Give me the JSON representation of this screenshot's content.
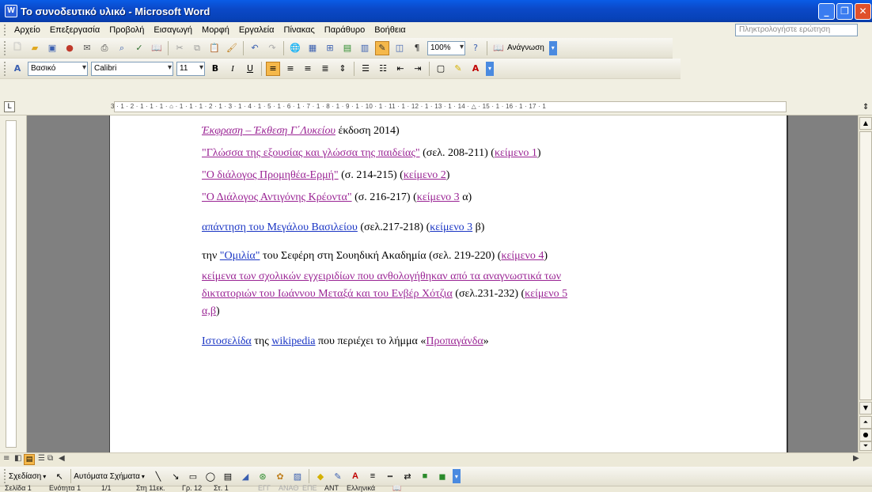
{
  "window": {
    "title": "Το συνοδευτικό υλικό - Microsoft Word"
  },
  "menu": {
    "items": [
      "Αρχείο",
      "Επεξεργασία",
      "Προβολή",
      "Εισαγωγή",
      "Μορφή",
      "Εργαλεία",
      "Πίνακας",
      "Παράθυρο",
      "Βοήθεια"
    ],
    "help_placeholder": "Πληκτρολογήστε ερώτηση"
  },
  "standard_toolbar": {
    "zoom": "100%",
    "reading_label": "Ανάγνωση"
  },
  "format_toolbar": {
    "style": "Βασικό",
    "font": "Calibri",
    "size": "11"
  },
  "ruler": {
    "marks": "3 · 1 · 2 · 1 · 1 · 1 · ⌂ · 1 · 1 · 1 · 2 · 1 · 3 · 1 · 4 · 1 · 5 · 1 · 6 · 1 · 7 · 1 · 8 · 1 · 9 · 1 · 10 · 1 · 11 · 1 · 12 · 1 · 13 · 1 · 14 · △ · 15 · 1 · 16 · 1 · 17 · 1"
  },
  "doc": {
    "l1_link": "Έκφραση – Έκθεση Γ΄Λυκείου",
    "l1_rest": " έκδοση 2014)",
    "l2_link": "\"Γλώσσα της εξουσίας και γλώσσα της παιδείας\"",
    "l2_mid": "  (σελ. 208-211) (",
    "l2_ref": "κείμενο 1",
    "l2_end": ")",
    "l3_link": " \"Ο διάλογος Προμηθέα-Ερμή\"",
    "l3_mid": " (σ. 214-215) (",
    "l3_ref": "κείμενο 2",
    "l3_end": ")",
    "l4_link": "\"Ο Διάλογος Αντιγόνης Κρέοντα\"",
    "l4_mid": " (σ. 216-217) (",
    "l4_ref": "κείμενο 3",
    "l4_end": " α)",
    "l5_link": " απάντηση του Μεγάλου Βασιλείου",
    "l5_mid": "  (σελ.217-218) (",
    "l5_ref": "κείμενο 3",
    "l5_end": " β)",
    "l6_pre": "την ",
    "l6_link": "\"Ομιλία\"",
    "l6_mid": "  του Σεφέρη στη Σουηδική Ακαδημία (σελ. 219-220)  (",
    "l6_ref": "κείμενο 4",
    "l6_end": ")",
    "l7a_link": "κείμενα των σχολικών εγχειριδίων που ανθολογήθηκαν από τα αναγνωστικά των",
    "l7b_link": "δικτατοριών του Ιωάννου Μεταξά και του Ενβέρ Χότζια",
    "l7b_mid": " (σελ.231-232) (",
    "l7b_ref": "κείμενο 5",
    "l7c_ref": "α,β",
    "l7c_end": ")",
    "l8_link": "Ιστοσελίδα",
    "l8_mid1": " της ",
    "l8_link2": "wikipedia",
    "l8_mid2": " που περιέχει το λήμμα «",
    "l8_link3": "Προπαγάνδα",
    "l8_end": "»"
  },
  "drawing": {
    "draw_label": "Σχεδίαση",
    "autoshapes_label": "Αυτόματα Σχήματα"
  },
  "status": {
    "page": "Σελίδα 1",
    "section": "Ενότητα 1",
    "count": "1/1",
    "at": "Στη 11εκ.",
    "line": "Γρ. 12",
    "col": "Στ. 1",
    "rec": "ΕΓΓ",
    "trk": "ΑΝΑΘ",
    "ext": "ΕΠΕ",
    "ovr": "ΑΝΤ",
    "lang": "Ελληνικά"
  }
}
